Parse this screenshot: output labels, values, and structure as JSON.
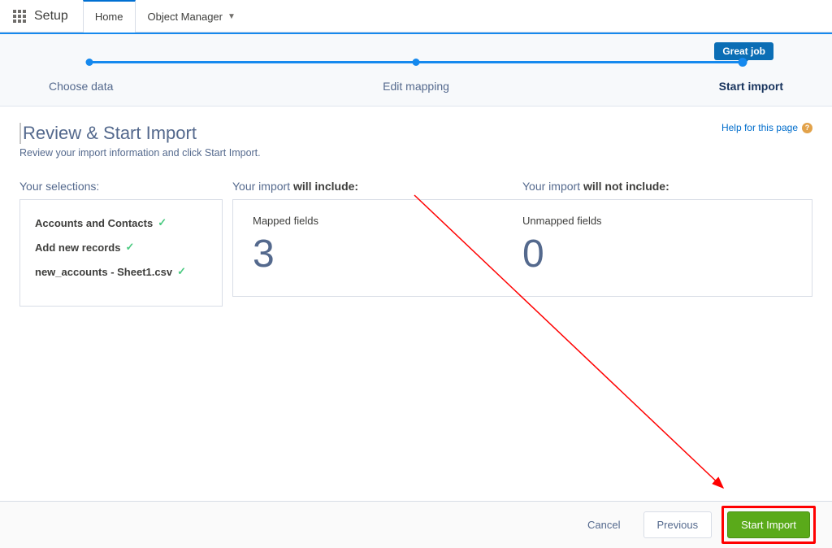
{
  "topnav": {
    "setup": "Setup",
    "home_tab": "Home",
    "object_manager_tab": "Object Manager"
  },
  "wizard": {
    "tooltip": "Great job",
    "steps": {
      "choose": "Choose data",
      "edit": "Edit mapping",
      "start": "Start import"
    }
  },
  "page": {
    "title": "Review & Start Import",
    "subtitle": "Review your import information and click Start Import.",
    "help_link": "Help for this page"
  },
  "selections": {
    "title": "Your selections:",
    "items": [
      "Accounts and Contacts",
      "Add new records",
      "new_accounts - Sheet1.csv"
    ]
  },
  "include": {
    "title_prefix": "Your import ",
    "title_bold": "will include:",
    "mapped_label": "Mapped fields",
    "mapped_value": "3"
  },
  "exclude": {
    "title_prefix": "Your import ",
    "title_bold": "will not include:",
    "unmapped_label": "Unmapped fields",
    "unmapped_value": "0"
  },
  "footer": {
    "cancel": "Cancel",
    "previous": "Previous",
    "start": "Start Import"
  }
}
